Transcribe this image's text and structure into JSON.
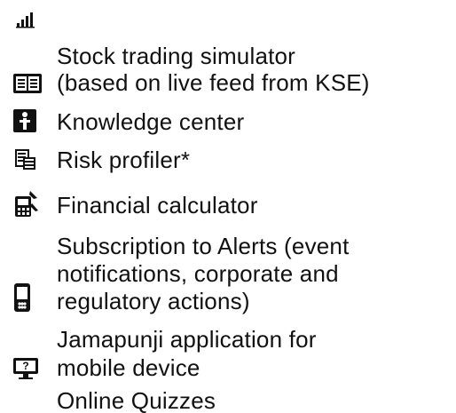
{
  "icons": {
    "top": "signal-bars-icon"
  },
  "items": [
    {
      "id": "stock",
      "icon": "book-icon",
      "label": "Stock trading simulator\n(based on live feed from KSE)"
    },
    {
      "id": "knowledge",
      "icon": "knowledge-icon",
      "label": "Knowledge center"
    },
    {
      "id": "risk",
      "icon": "document-stack-icon",
      "label": "Risk profiler*"
    },
    {
      "id": "financial",
      "icon": "calculator-icon",
      "label": "Financial calculator"
    },
    {
      "id": "alerts",
      "icon": "mobile-phone-icon",
      "label": "Subscription to Alerts (event\nnotifications, corporate and\nregulatory actions)"
    },
    {
      "id": "jamapunji",
      "icon": "monitor-question-icon",
      "label": "Jamapunji application for\nmobile device"
    },
    {
      "id": "quizzes",
      "icon": "",
      "label": "Online Quizzes"
    }
  ]
}
